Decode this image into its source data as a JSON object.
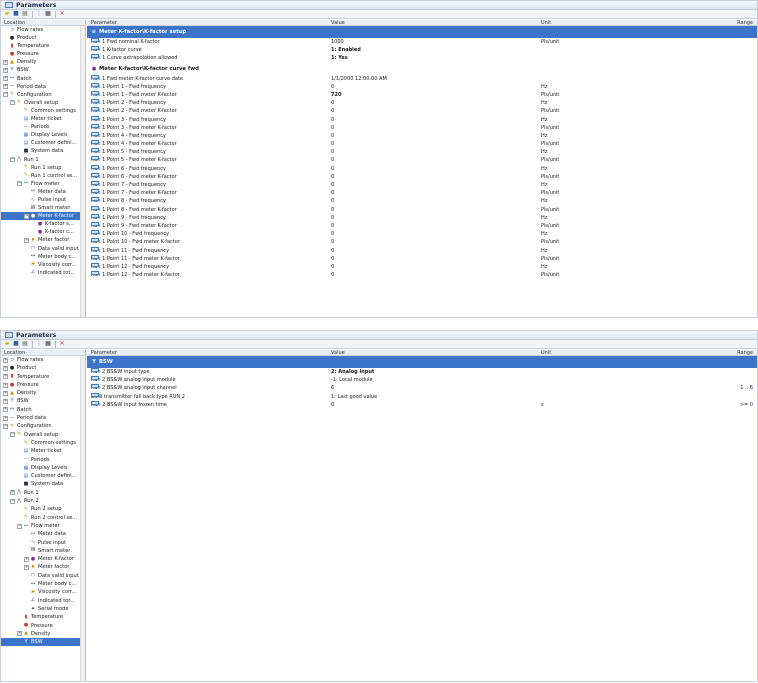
{
  "window_title": "Parameters",
  "columns": {
    "location": "Location",
    "parameter": "Parameter",
    "value": "Value",
    "unit": "Unit",
    "range": "Range"
  },
  "panel1": {
    "tree": [
      {
        "indent": 0,
        "exp": "",
        "icon": "flow-rates-icon",
        "label": "Flow rates"
      },
      {
        "indent": 0,
        "exp": "",
        "icon": "product-icon",
        "label": "Product"
      },
      {
        "indent": 0,
        "exp": "",
        "icon": "temperature-icon",
        "label": "Temperature"
      },
      {
        "indent": 0,
        "exp": "",
        "icon": "pressure-icon",
        "label": "Pressure"
      },
      {
        "indent": 0,
        "exp": "+",
        "icon": "density-icon",
        "label": "Density"
      },
      {
        "indent": 0,
        "exp": "+",
        "icon": "bsw-icon",
        "label": "BSW"
      },
      {
        "indent": 0,
        "exp": "+",
        "icon": "batch-icon",
        "label": "Batch"
      },
      {
        "indent": 0,
        "exp": "+",
        "icon": "period-data-icon",
        "label": "Period data"
      },
      {
        "indent": 0,
        "exp": "−",
        "icon": "configuration-icon",
        "label": "Configuration"
      },
      {
        "indent": 1,
        "exp": "−",
        "icon": "overall-setup-icon",
        "label": "Overall setup"
      },
      {
        "indent": 2,
        "exp": "",
        "icon": "common-settings-icon",
        "label": "Common settings"
      },
      {
        "indent": 2,
        "exp": "",
        "icon": "meter-ticket-icon",
        "label": "Meter ticket"
      },
      {
        "indent": 2,
        "exp": "",
        "icon": "periods-icon",
        "label": "Periods"
      },
      {
        "indent": 2,
        "exp": "",
        "icon": "display-levels-icon",
        "label": "Display Levels"
      },
      {
        "indent": 2,
        "exp": "",
        "icon": "customer-defined-icon",
        "label": "Customer defini..."
      },
      {
        "indent": 2,
        "exp": "",
        "icon": "system-data-icon",
        "label": "System data"
      },
      {
        "indent": 1,
        "exp": "−",
        "icon": "run-icon",
        "label": "Run 1"
      },
      {
        "indent": 2,
        "exp": "",
        "icon": "run-setup-icon",
        "label": "Run 1 setup"
      },
      {
        "indent": 2,
        "exp": "",
        "icon": "run-control-icon",
        "label": "Run 1 control se..."
      },
      {
        "indent": 2,
        "exp": "−",
        "icon": "flow-meter-icon",
        "label": "Flow meter"
      },
      {
        "indent": 3,
        "exp": "",
        "icon": "meter-data-icon",
        "label": "Meter data"
      },
      {
        "indent": 3,
        "exp": "",
        "icon": "pulse-input-icon",
        "label": "Pulse input"
      },
      {
        "indent": 3,
        "exp": "",
        "icon": "smart-meter-icon",
        "label": "Smart meter"
      },
      {
        "indent": 3,
        "exp": "−",
        "icon": "meter-kfactor-icon",
        "label": "Meter K-factor",
        "selected": true
      },
      {
        "indent": 4,
        "exp": "",
        "icon": "kfactor-icon",
        "label": "K-factor s..."
      },
      {
        "indent": 4,
        "exp": "",
        "icon": "kfactor-icon",
        "label": "K-factor c..."
      },
      {
        "indent": 3,
        "exp": "+",
        "icon": "meter-factor-icon",
        "label": "Meter factor"
      },
      {
        "indent": 3,
        "exp": "",
        "icon": "data-valid-icon",
        "label": "Data valid input"
      },
      {
        "indent": 3,
        "exp": "",
        "icon": "meter-body-icon",
        "label": "Meter body c..."
      },
      {
        "indent": 3,
        "exp": "",
        "icon": "viscosity-icon",
        "label": "Viscosity corr..."
      },
      {
        "indent": 3,
        "exp": "",
        "icon": "indicated-icon",
        "label": "Indicated tot..."
      }
    ],
    "groups": [
      {
        "title": "Meter K-factor\\K-factor setup",
        "active": true,
        "icon": "collapse-icon",
        "rows": [
          {
            "name": "Run 1 Fwd nominal K-factor",
            "value": "1000",
            "unit": "Pls/unit",
            "range": "",
            "bold": false
          },
          {
            "name": "Run 1 K-factor curve",
            "value": "1: Enabled",
            "unit": "",
            "range": "",
            "bold": true
          },
          {
            "name": "Run 1 Curve extrapolation allowed",
            "value": "1: Yes",
            "unit": "",
            "range": "",
            "bold": true
          }
        ]
      },
      {
        "title": "Meter K-factor\\K-factor curve fwd",
        "active": false,
        "icon": "kfactor-icon",
        "rows": [
          {
            "name": "Run 1 Fwd meter K-factor curve date",
            "value": "1/1/2000 12:00:00 AM",
            "unit": "",
            "range": "",
            "bold": false
          },
          {
            "name": "Run 1 Point 1 - Fwd frequency",
            "value": "0",
            "unit": "Hz",
            "range": "",
            "bold": false
          },
          {
            "name": "Run 1 Point 1 - Fwd meter K-factor",
            "value": "720",
            "unit": "Pls/unit",
            "range": "",
            "bold": true
          },
          {
            "name": "Run 1 Point 2 - Fwd frequency",
            "value": "0",
            "unit": "Hz",
            "range": "",
            "bold": false
          },
          {
            "name": "Run 1 Point 2 - Fwd meter K-factor",
            "value": "0",
            "unit": "Pls/unit",
            "range": "",
            "bold": false
          },
          {
            "name": "Run 1 Point 3 - Fwd frequency",
            "value": "0",
            "unit": "Hz",
            "range": "",
            "bold": false
          },
          {
            "name": "Run 1 Point 3 - Fwd meter K-factor",
            "value": "0",
            "unit": "Pls/unit",
            "range": "",
            "bold": false
          },
          {
            "name": "Run 1 Point 4 - Fwd frequency",
            "value": "0",
            "unit": "Hz",
            "range": "",
            "bold": false
          },
          {
            "name": "Run 1 Point 4 - Fwd meter K-factor",
            "value": "0",
            "unit": "Pls/unit",
            "range": "",
            "bold": false
          },
          {
            "name": "Run 1 Point 5 - Fwd frequency",
            "value": "0",
            "unit": "Hz",
            "range": "",
            "bold": false
          },
          {
            "name": "Run 1 Point 5 - Fwd meter K-factor",
            "value": "0",
            "unit": "Pls/unit",
            "range": "",
            "bold": false
          },
          {
            "name": "Run 1 Point 6 - Fwd frequency",
            "value": "0",
            "unit": "Hz",
            "range": "",
            "bold": false
          },
          {
            "name": "Run 1 Point 6 - Fwd meter K-factor",
            "value": "0",
            "unit": "Pls/unit",
            "range": "",
            "bold": false
          },
          {
            "name": "Run 1 Point 7 - Fwd frequency",
            "value": "0",
            "unit": "Hz",
            "range": "",
            "bold": false
          },
          {
            "name": "Run 1 Point 7 - Fwd meter K-factor",
            "value": "0",
            "unit": "Pls/unit",
            "range": "",
            "bold": false
          },
          {
            "name": "Run 1 Point 8 - Fwd frequency",
            "value": "0",
            "unit": "Hz",
            "range": "",
            "bold": false
          },
          {
            "name": "Run 1 Point 8 - Fwd meter K-factor",
            "value": "0",
            "unit": "Pls/unit",
            "range": "",
            "bold": false
          },
          {
            "name": "Run 1 Point 9 - Fwd frequency",
            "value": "0",
            "unit": "Hz",
            "range": "",
            "bold": false
          },
          {
            "name": "Run 1 Point 9 - Fwd meter K-factor",
            "value": "0",
            "unit": "Pls/unit",
            "range": "",
            "bold": false
          },
          {
            "name": "Run 1 Point 10 - Fwd frequency",
            "value": "0",
            "unit": "Hz",
            "range": "",
            "bold": false
          },
          {
            "name": "Run 1 Point 10 - Fwd meter K-factor",
            "value": "0",
            "unit": "Pls/unit",
            "range": "",
            "bold": false
          },
          {
            "name": "Run 1 Point 11 - Fwd frequency",
            "value": "0",
            "unit": "Hz",
            "range": "",
            "bold": false
          },
          {
            "name": "Run 1 Point 11 - Fwd meter K-factor",
            "value": "0",
            "unit": "Pls/unit",
            "range": "",
            "bold": false
          },
          {
            "name": "Run 1 Point 12 - Fwd frequency",
            "value": "0",
            "unit": "Hz",
            "range": "",
            "bold": false
          },
          {
            "name": "Run 1 Point 12 - Fwd meter K-factor",
            "value": "0",
            "unit": "Pls/unit",
            "range": "",
            "bold": false
          }
        ]
      }
    ]
  },
  "panel2": {
    "tree": [
      {
        "indent": 0,
        "exp": "+",
        "icon": "flow-rates-icon",
        "label": "Flow rates"
      },
      {
        "indent": 0,
        "exp": "+",
        "icon": "product-icon",
        "label": "Product"
      },
      {
        "indent": 0,
        "exp": "+",
        "icon": "temperature-icon",
        "label": "Temperature"
      },
      {
        "indent": 0,
        "exp": "+",
        "icon": "pressure-icon",
        "label": "Pressure"
      },
      {
        "indent": 0,
        "exp": "+",
        "icon": "density-icon",
        "label": "Density"
      },
      {
        "indent": 0,
        "exp": "+",
        "icon": "bsw-icon",
        "label": "BSW"
      },
      {
        "indent": 0,
        "exp": "+",
        "icon": "batch-icon",
        "label": "Batch"
      },
      {
        "indent": 0,
        "exp": "+",
        "icon": "period-data-icon",
        "label": "Period data"
      },
      {
        "indent": 0,
        "exp": "−",
        "icon": "configuration-icon",
        "label": "Configuration"
      },
      {
        "indent": 1,
        "exp": "−",
        "icon": "overall-setup-icon",
        "label": "Overall setup"
      },
      {
        "indent": 2,
        "exp": "",
        "icon": "common-settings-icon",
        "label": "Common settings"
      },
      {
        "indent": 2,
        "exp": "",
        "icon": "meter-ticket-icon",
        "label": "Meter ticket"
      },
      {
        "indent": 2,
        "exp": "",
        "icon": "periods-icon",
        "label": "Periods"
      },
      {
        "indent": 2,
        "exp": "",
        "icon": "display-levels-icon",
        "label": "Display Levels"
      },
      {
        "indent": 2,
        "exp": "",
        "icon": "customer-defined-icon",
        "label": "Customer defini..."
      },
      {
        "indent": 2,
        "exp": "",
        "icon": "system-data-icon",
        "label": "System data"
      },
      {
        "indent": 1,
        "exp": "+",
        "icon": "run-icon",
        "label": "Run 1"
      },
      {
        "indent": 1,
        "exp": "−",
        "icon": "run-icon",
        "label": "Run 2"
      },
      {
        "indent": 2,
        "exp": "",
        "icon": "run-setup-icon",
        "label": "Run 2 setup"
      },
      {
        "indent": 2,
        "exp": "",
        "icon": "run-control-icon",
        "label": "Run 2 control se..."
      },
      {
        "indent": 2,
        "exp": "−",
        "icon": "flow-meter-icon",
        "label": "Flow meter"
      },
      {
        "indent": 3,
        "exp": "",
        "icon": "meter-data-icon",
        "label": "Meter data"
      },
      {
        "indent": 3,
        "exp": "",
        "icon": "pulse-input-icon",
        "label": "Pulse input"
      },
      {
        "indent": 3,
        "exp": "",
        "icon": "smart-meter-icon",
        "label": "Smart meter"
      },
      {
        "indent": 3,
        "exp": "+",
        "icon": "meter-kfactor-icon",
        "label": "Meter K-factor"
      },
      {
        "indent": 3,
        "exp": "+",
        "icon": "meter-factor-icon",
        "label": "Meter factor"
      },
      {
        "indent": 3,
        "exp": "",
        "icon": "data-valid-icon",
        "label": "Data valid input"
      },
      {
        "indent": 3,
        "exp": "",
        "icon": "meter-body-icon",
        "label": "Meter body c..."
      },
      {
        "indent": 3,
        "exp": "",
        "icon": "viscosity-icon",
        "label": "Viscosity corr..."
      },
      {
        "indent": 3,
        "exp": "",
        "icon": "indicated-icon",
        "label": "Indicated tot..."
      },
      {
        "indent": 3,
        "exp": "",
        "icon": "serial-mode-icon",
        "label": "Serial mode"
      },
      {
        "indent": 2,
        "exp": "",
        "icon": "temperature-icon",
        "label": "Temperature"
      },
      {
        "indent": 2,
        "exp": "",
        "icon": "pressure-icon",
        "label": "Pressure"
      },
      {
        "indent": 2,
        "exp": "+",
        "icon": "density-icon",
        "label": "Density"
      },
      {
        "indent": 2,
        "exp": "",
        "icon": "bsw-icon",
        "label": "BSW",
        "selected": true
      }
    ],
    "groups": [
      {
        "title": "BSW",
        "active": true,
        "icon": "bsw-icon",
        "rows": [
          {
            "name": "Run 2 BS&W input type",
            "value": "2: Analog input",
            "unit": "",
            "range": "",
            "bold": true
          },
          {
            "name": "Run 2 BS&W analog input module",
            "value": "-1: Local module",
            "unit": "",
            "range": "",
            "bold": false
          },
          {
            "name": "Run 2 BS&W analog input channel",
            "value": "6",
            "unit": "",
            "range": "1 .. 6",
            "bold": false
          },
          {
            "name": "BSW transmitter fall back type RUN 2",
            "value": "1: Last good value",
            "unit": "",
            "range": "",
            "bold": false
          },
          {
            "name": "Run 2 BS&W input frozen time",
            "value": "0",
            "unit": "s",
            "range": ">= 0",
            "bold": false
          }
        ]
      }
    ]
  }
}
